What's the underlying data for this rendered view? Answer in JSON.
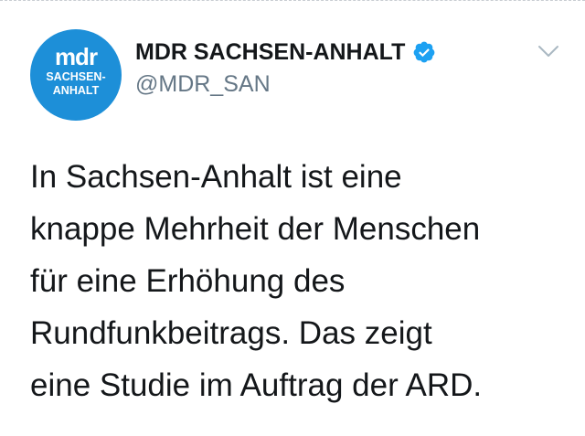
{
  "tweet": {
    "author": {
      "display_name": "MDR SACHSEN-ANHALT",
      "handle": "@MDR_SAN",
      "verified": true,
      "avatar": {
        "logo_text": "mdr",
        "line1": "SACHSEN-",
        "line2": "ANHALT",
        "background_color": "#1d8fd8"
      }
    },
    "text_lines": [
      "In Sachsen-Anhalt ist eine",
      "knappe Mehrheit der Menschen",
      "für eine Erhöhung des",
      "Rundfunkbeitrags. Das zeigt",
      "eine Studie im Auftrag der ARD."
    ],
    "icons": {
      "verified": "verified-badge-icon",
      "menu": "chevron-down-icon"
    },
    "colors": {
      "text": "#14171a",
      "secondary": "#657786",
      "verified": "#1da1f2"
    }
  }
}
